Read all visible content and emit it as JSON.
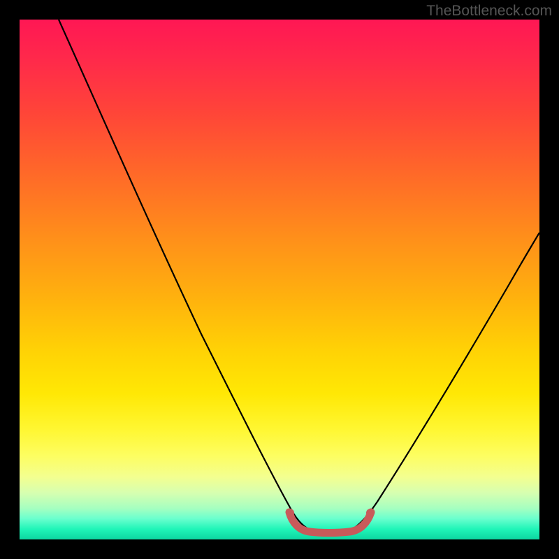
{
  "watermark": "TheBottleneck.com",
  "chart_data": {
    "type": "line",
    "title": "",
    "xlabel": "",
    "ylabel": "",
    "xlim": [
      0,
      100
    ],
    "ylim": [
      0,
      100
    ],
    "series": [
      {
        "name": "bottleneck-curve",
        "color": "#000000",
        "x": [
          10,
          15,
          20,
          25,
          30,
          35,
          40,
          45,
          50,
          52,
          55,
          58,
          60,
          63,
          65,
          70,
          75,
          80,
          85,
          90,
          95,
          100
        ],
        "y": [
          100,
          90,
          80,
          70,
          60,
          50,
          40,
          30,
          18,
          10,
          3,
          1,
          1,
          1,
          3,
          10,
          18,
          26,
          34,
          42,
          50,
          58
        ]
      },
      {
        "name": "optimal-zone-marker",
        "color": "#c85a5a",
        "x": [
          52,
          54,
          56,
          58,
          60,
          62,
          64,
          65
        ],
        "y": [
          4,
          2,
          1.2,
          1,
          1,
          1.2,
          2,
          4
        ]
      }
    ],
    "gradient_stops": [
      {
        "pos": 0,
        "color": "#ff1754"
      },
      {
        "pos": 50,
        "color": "#ffb30d"
      },
      {
        "pos": 80,
        "color": "#fff733"
      },
      {
        "pos": 100,
        "color": "#0dd6a0"
      }
    ]
  }
}
